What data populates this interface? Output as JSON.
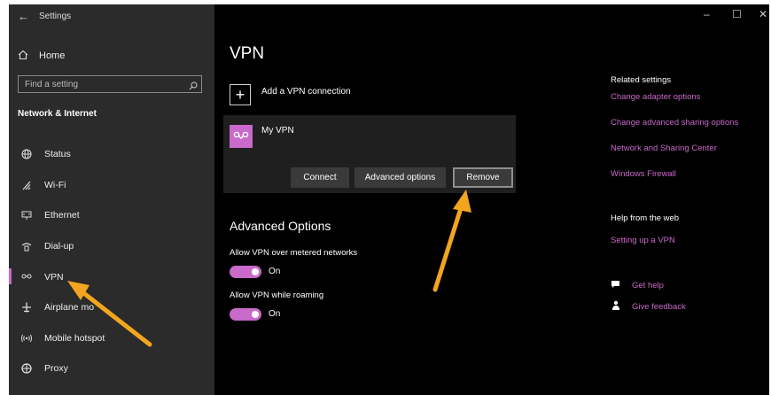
{
  "app": {
    "title": "Settings"
  },
  "window_controls": {
    "minimize": "–",
    "maximize": "☐",
    "close": "✕"
  },
  "sidebar": {
    "home_label": "Home",
    "search_placeholder": "Find a setting",
    "section_title": "Network & Internet",
    "items": [
      {
        "label": "Status",
        "icon": "globe-icon"
      },
      {
        "label": "Wi-Fi",
        "icon": "wifi-icon"
      },
      {
        "label": "Ethernet",
        "icon": "ethernet-icon"
      },
      {
        "label": "Dial-up",
        "icon": "dialup-icon"
      },
      {
        "label": "VPN",
        "icon": "vpn-icon",
        "active": true
      },
      {
        "label": "Airplane mo",
        "icon": "airplane-icon"
      },
      {
        "label": "Mobile hotspot",
        "icon": "hotspot-icon"
      },
      {
        "label": "Proxy",
        "icon": "proxy-icon"
      }
    ]
  },
  "main": {
    "title": "VPN",
    "add_vpn_label": "Add a VPN connection",
    "vpn": {
      "name": "My VPN",
      "buttons": {
        "connect": "Connect",
        "advanced": "Advanced options",
        "remove": "Remove"
      }
    },
    "advanced": {
      "title": "Advanced Options",
      "options": [
        {
          "label": "Allow VPN over metered networks",
          "state": "On"
        },
        {
          "label": "Allow VPN while roaming",
          "state": "On"
        }
      ]
    }
  },
  "related": {
    "heading": "Related settings",
    "links": [
      "Change adapter options",
      "Change advanced sharing options",
      "Network and Sharing Center",
      "Windows Firewall"
    ],
    "help_heading": "Help from the web",
    "help_link": "Setting up a VPN",
    "get_help": "Get help",
    "give_feedback": "Give feedback"
  },
  "colors": {
    "accent": "#c969c9",
    "sidebar_bg": "#2b2b2b",
    "main_bg": "#000000",
    "card_bg": "#1f1f1f",
    "annotation_arrow": "#f2a51e"
  }
}
